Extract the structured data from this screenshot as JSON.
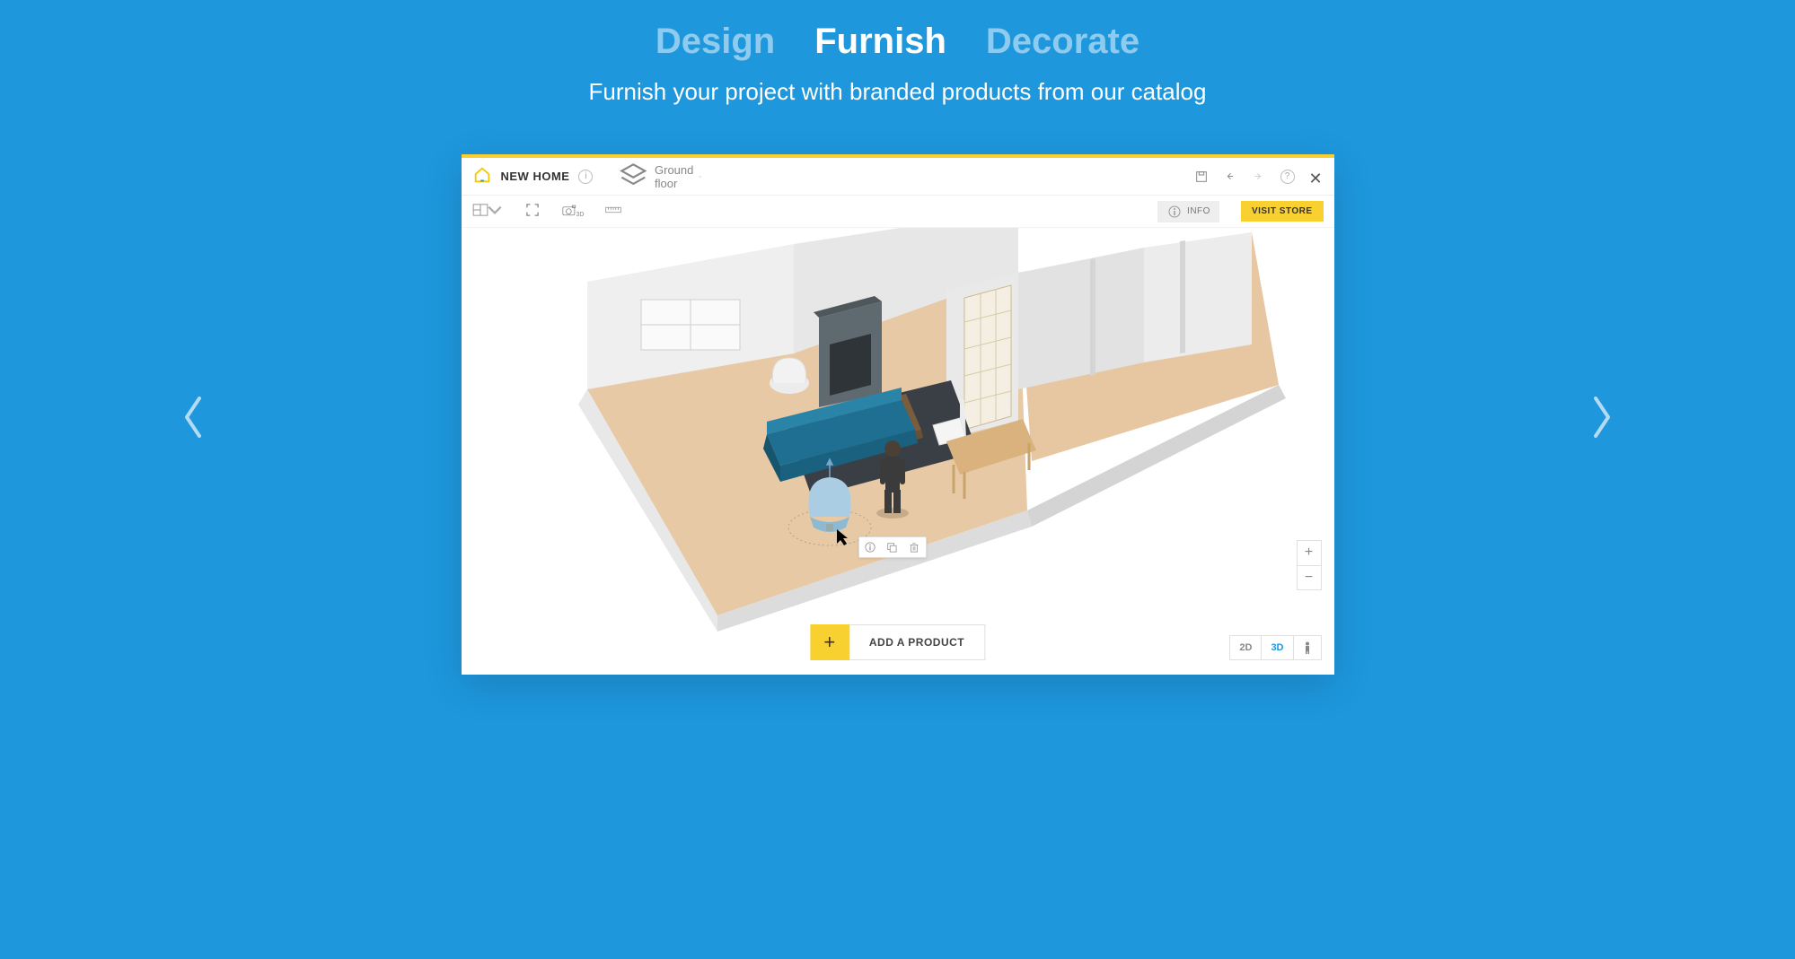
{
  "header": {
    "tabs": [
      "Design",
      "Furnish",
      "Decorate"
    ],
    "active_tab_index": 1,
    "subtitle": "Furnish your project with branded products from our catalog"
  },
  "app": {
    "project_name": "NEW HOME",
    "floor_label": "Ground floor",
    "secondbar": {
      "info_label": "INFO",
      "visit_store_label": "VISIT STORE"
    },
    "add_product_label": "ADD A PRODUCT",
    "view_switch": {
      "mode_2d": "2D",
      "mode_3d": "3D"
    },
    "zoom": {
      "in": "+",
      "out": "−"
    }
  }
}
